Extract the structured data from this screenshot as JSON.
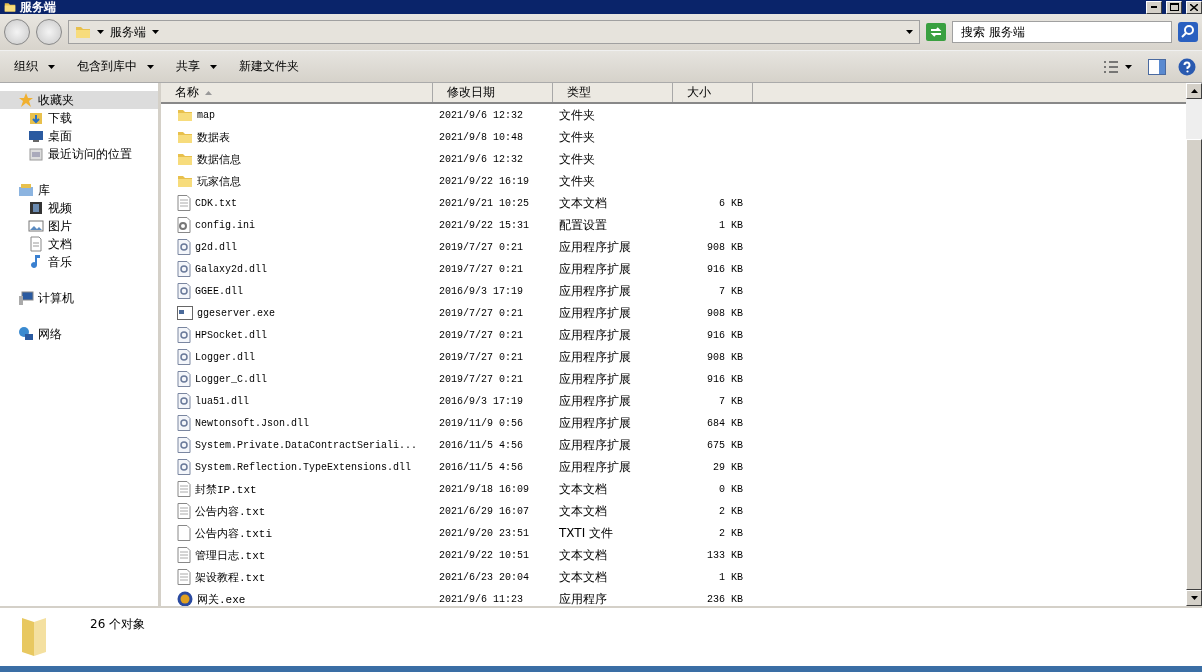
{
  "window": {
    "title": "服务端"
  },
  "address": {
    "crumb": "服务端"
  },
  "search": {
    "placeholder": "搜索 服务端"
  },
  "toolbar": [
    "组织",
    "包含到库中",
    "共享",
    "新建文件夹"
  ],
  "toolbar_dropdowns": [
    true,
    true,
    true,
    false
  ],
  "sidebar": [
    {
      "label": "收藏夹",
      "kind": "star",
      "selected": true,
      "children": [
        {
          "label": "下载",
          "kind": "download",
          "selected": false
        },
        {
          "label": "桌面",
          "kind": "desktop",
          "selected": false
        },
        {
          "label": "最近访问的位置",
          "kind": "recent",
          "selected": false
        }
      ]
    },
    {
      "label": "库",
      "kind": "library",
      "selected": false,
      "children": [
        {
          "label": "视频",
          "kind": "video",
          "selected": false
        },
        {
          "label": "图片",
          "kind": "image",
          "selected": false
        },
        {
          "label": "文档",
          "kind": "doc",
          "selected": false
        },
        {
          "label": "音乐",
          "kind": "music",
          "selected": false
        }
      ]
    },
    {
      "label": "计算机",
      "kind": "computer",
      "selected": false
    },
    {
      "label": "网络",
      "kind": "network",
      "selected": false
    }
  ],
  "columns": [
    {
      "label": "名称",
      "sorted": true
    },
    {
      "label": "修改日期",
      "sorted": false
    },
    {
      "label": "类型",
      "sorted": false
    },
    {
      "label": "大小",
      "sorted": false
    }
  ],
  "files": [
    {
      "name": "map",
      "date": "2021/9/6 12:32",
      "type": "文件夹",
      "kind": "folder"
    },
    {
      "name": "数据表",
      "date": "2021/9/8 10:48",
      "type": "文件夹",
      "kind": "folder"
    },
    {
      "name": "数据信息",
      "date": "2021/9/6 12:32",
      "type": "文件夹",
      "kind": "folder"
    },
    {
      "name": "玩家信息",
      "date": "2021/9/22 16:19",
      "type": "文件夹",
      "kind": "folder"
    },
    {
      "name": "CDK.txt",
      "date": "2021/9/21 10:25",
      "type": "文本文档",
      "size": "6 KB",
      "kind": "text"
    },
    {
      "name": "config.ini",
      "date": "2021/9/22 15:31",
      "type": "配置设置",
      "size": "1 KB",
      "kind": "config"
    },
    {
      "name": "g2d.dll",
      "date": "2019/7/27 0:21",
      "type": "应用程序扩展",
      "size": "908 KB",
      "kind": "dll"
    },
    {
      "name": "Galaxy2d.dll",
      "date": "2019/7/27 0:21",
      "type": "应用程序扩展",
      "size": "916 KB",
      "kind": "dll"
    },
    {
      "name": "GGEE.dll",
      "date": "2016/9/3 17:19",
      "type": "应用程序扩展",
      "size": "7 KB",
      "kind": "dll"
    },
    {
      "name": "ggeserver.exe",
      "date": "2019/7/27 0:21",
      "type": "应用程序扩展",
      "size": "908 KB",
      "kind": "exe"
    },
    {
      "name": "HPSocket.dll",
      "date": "2019/7/27 0:21",
      "type": "应用程序扩展",
      "size": "916 KB",
      "kind": "dll"
    },
    {
      "name": "Logger.dll",
      "date": "2019/7/27 0:21",
      "type": "应用程序扩展",
      "size": "908 KB",
      "kind": "dll"
    },
    {
      "name": "Logger_C.dll",
      "date": "2019/7/27 0:21",
      "type": "应用程序扩展",
      "size": "916 KB",
      "kind": "dll"
    },
    {
      "name": "lua51.dll",
      "date": "2016/9/3 17:19",
      "type": "应用程序扩展",
      "size": "7 KB",
      "kind": "dll"
    },
    {
      "name": "Newtonsoft.Json.dll",
      "date": "2019/11/9 0:56",
      "type": "应用程序扩展",
      "size": "684 KB",
      "kind": "dll"
    },
    {
      "name": "System.Private.DataContractSeriali...",
      "date": "2016/11/5 4:56",
      "type": "应用程序扩展",
      "size": "675 KB",
      "kind": "dll"
    },
    {
      "name": "System.Reflection.TypeExtensions.dll",
      "date": "2016/11/5 4:56",
      "type": "应用程序扩展",
      "size": "29 KB",
      "kind": "dll"
    },
    {
      "name": "封禁IP.txt",
      "date": "2021/9/18 16:09",
      "type": "文本文档",
      "size": "0 KB",
      "kind": "text"
    },
    {
      "name": "公告内容.txt",
      "date": "2021/6/29 16:07",
      "type": "文本文档",
      "size": "2 KB",
      "kind": "text"
    },
    {
      "name": "公告内容.txti",
      "date": "2021/9/20 23:51",
      "type": "TXTI 文件",
      "size": "2 KB",
      "kind": "blank"
    },
    {
      "name": "管理日志.txt",
      "date": "2021/9/22 10:51",
      "type": "文本文档",
      "size": "133 KB",
      "kind": "text"
    },
    {
      "name": "架设教程.txt",
      "date": "2021/6/23 20:04",
      "type": "文本文档",
      "size": "1 KB",
      "kind": "text"
    },
    {
      "name": "网关.exe",
      "date": "2021/9/6 11:23",
      "type": "应用程序",
      "size": "236 KB",
      "kind": "app"
    }
  ],
  "status_bar": {
    "count": "26 个对象"
  }
}
